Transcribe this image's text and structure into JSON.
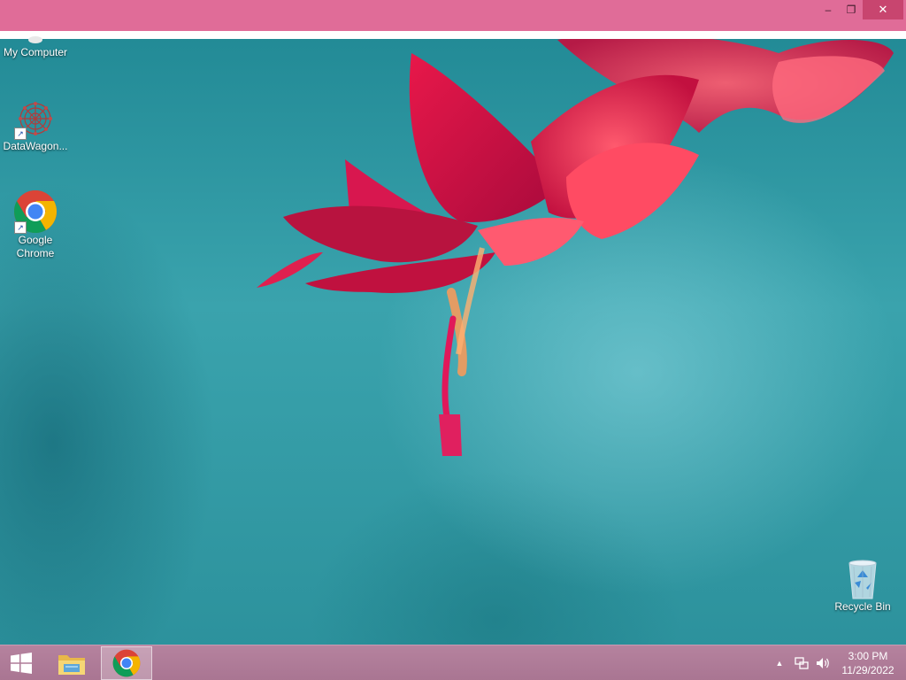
{
  "window": {
    "minimize_glyph": "–",
    "restore_glyph": "❐",
    "close_glyph": "✕"
  },
  "desktop": {
    "icons": [
      {
        "label": "My Computer",
        "icon": "computer-icon"
      },
      {
        "label": "DataWagon...",
        "icon": "datawagon-icon"
      },
      {
        "label": "Google Chrome",
        "label_line1": "Google",
        "label_line2": "Chrome",
        "icon": "chrome-icon"
      },
      {
        "label": "Recycle Bin",
        "icon": "recycle-bin-icon"
      }
    ]
  },
  "taskbar": {
    "buttons": [
      {
        "name": "start",
        "icon": "windows-logo-icon"
      },
      {
        "name": "file-explorer",
        "icon": "folder-icon"
      },
      {
        "name": "google-chrome",
        "icon": "chrome-icon",
        "active": true
      }
    ],
    "tray": {
      "show_hidden_glyph": "▲",
      "icons": [
        "network-icon",
        "volume-icon"
      ]
    },
    "clock": {
      "time": "3:00 PM",
      "date": "11/29/2022"
    }
  },
  "colors": {
    "titlebar": "#e06c98",
    "close_button": "#c8456f",
    "taskbar": "#b5829e",
    "wallpaper": "#2a8d99",
    "flower": "#e0204f"
  }
}
